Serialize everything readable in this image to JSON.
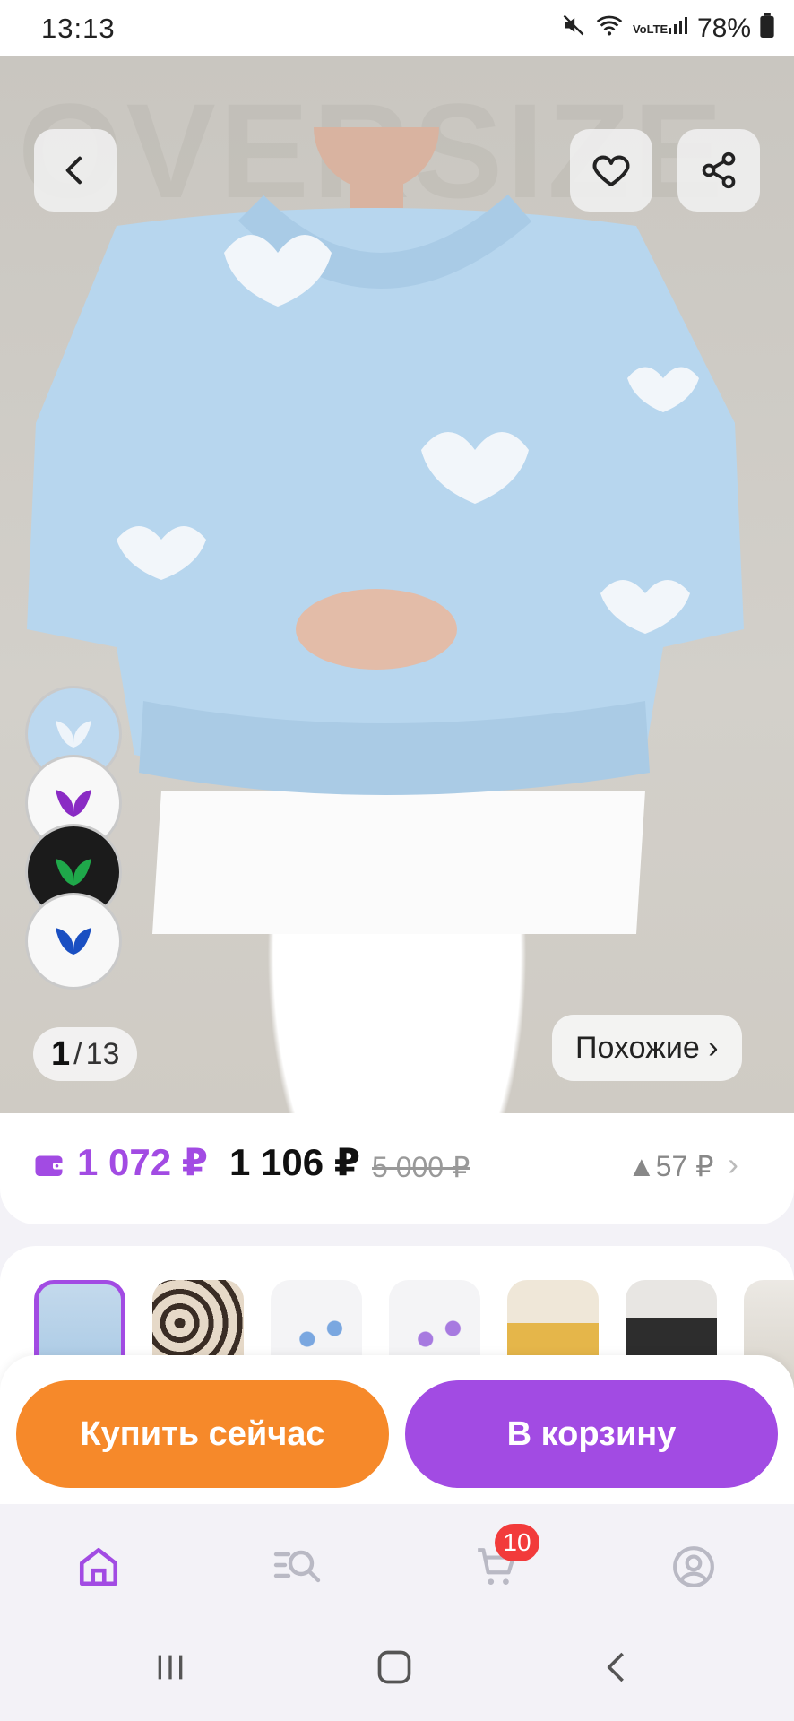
{
  "status_bar": {
    "time": "13:13",
    "battery": "78%",
    "network": "VoLTE"
  },
  "hero": {
    "bg_text": "OVERSIZE",
    "image_counter": {
      "current": "1",
      "separator": "/",
      "total": "13"
    },
    "similar_label": "Похожие ›"
  },
  "price": {
    "wallet_price": "1 072 ₽",
    "price": "1 106 ₽",
    "old_price": "5 000 ₽",
    "price_change": "▲57 ₽"
  },
  "actions": {
    "buy_now": "Купить сейчас",
    "add_to_cart": "В корзину"
  },
  "nav": {
    "cart_badge": "10"
  },
  "colors": {
    "accent": "#a24be3",
    "buy": "#f6892a",
    "badge": "#f23b3b"
  }
}
